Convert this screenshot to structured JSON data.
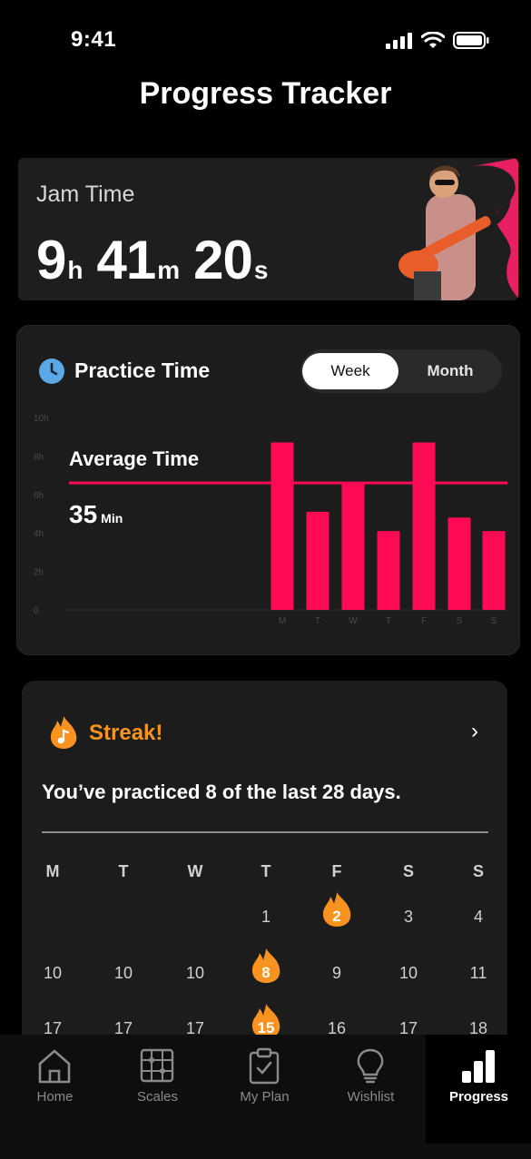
{
  "status_bar": {
    "time": "9:41"
  },
  "page_title": "Progress Tracker",
  "jam": {
    "label": "Jam Time",
    "hours": "9",
    "hours_unit": "h",
    "minutes": "41",
    "minutes_unit": "m",
    "seconds": "20",
    "seconds_unit": "s"
  },
  "practice": {
    "title": "Practice Time",
    "toggle": {
      "week": "Week",
      "month": "Month",
      "selected": "Week"
    },
    "average_label": "Average Time",
    "average_value": "35",
    "average_unit": "Min"
  },
  "chart_data": {
    "type": "bar",
    "categories": [
      "M",
      "T",
      "W",
      "T",
      "F",
      "S",
      "S"
    ],
    "values": [
      8.7,
      5.1,
      6.6,
      4.1,
      8.7,
      4.8,
      4.1
    ],
    "y_ticks": [
      "0",
      "2h",
      "4h",
      "6h",
      "8h",
      "10h"
    ],
    "ylim": [
      0,
      10
    ],
    "average_line": 6.6,
    "bar_color": "#ff0a54"
  },
  "streak": {
    "title": "Streak!",
    "text": "You’ve practiced 8 of the last 28 days.",
    "weekdays": [
      "M",
      "T",
      "W",
      "T",
      "F",
      "S",
      "S"
    ],
    "rows": [
      [
        "",
        "",
        "",
        "1",
        "2",
        "3",
        "4"
      ],
      [
        "10",
        "10",
        "10",
        "8",
        "9",
        "10",
        "11"
      ],
      [
        "17",
        "17",
        "17",
        "15",
        "16",
        "17",
        "18"
      ]
    ],
    "active_days": [
      "2",
      "8",
      "15"
    ],
    "accent": "#f7931e"
  },
  "tabs": [
    {
      "label": "Home",
      "icon": "home-icon"
    },
    {
      "label": "Scales",
      "icon": "grid-icon"
    },
    {
      "label": "My Plan",
      "icon": "clipboard-icon"
    },
    {
      "label": "Wishlist",
      "icon": "lightbulb-icon"
    },
    {
      "label": "Progress",
      "icon": "bar-chart-icon",
      "active": true
    }
  ]
}
